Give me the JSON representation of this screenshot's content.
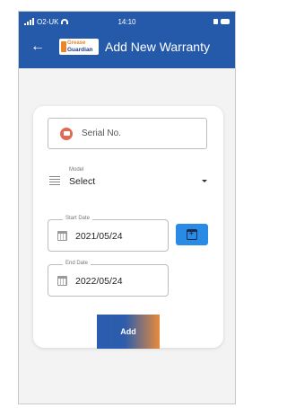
{
  "status_bar": {
    "carrier": "O2-UK",
    "time": "14:10"
  },
  "app_bar": {
    "logo_line1": "Grease",
    "logo_line2": "Guardian",
    "title": "Add New Warranty"
  },
  "form": {
    "serial_placeholder": "Serial No.",
    "model": {
      "label": "Model",
      "value": "Select"
    },
    "start_date": {
      "label": "Start Date",
      "value": "2021/05/24"
    },
    "end_date": {
      "label": "End Date",
      "value": "2022/05/24"
    },
    "submit_label": "Add"
  },
  "colors": {
    "header": "#255aab",
    "accent": "#2a8be6",
    "button_gradient_end": "#e88a3a"
  }
}
